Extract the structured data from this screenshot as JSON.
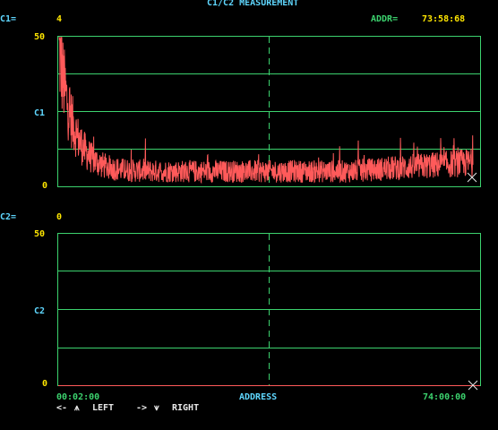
{
  "header": {
    "title": "C1/C2 MEASUREMENT",
    "addr_label": "ADDR=",
    "addr_value": "73:58:68"
  },
  "panel1": {
    "readout_label": "C1=",
    "readout_value": "4",
    "y_top": "50",
    "y_mid": "C1",
    "y_bottom": "0"
  },
  "panel2": {
    "readout_label": "C2=",
    "readout_value": "0",
    "y_top": "50",
    "y_mid": "C2",
    "y_bottom": "0"
  },
  "xaxis": {
    "start": "00:02:00",
    "label": "ADDRESS",
    "end": "74:00:00"
  },
  "footer": {
    "left_hint": "<-",
    "left_arrow": "⩚",
    "left_label": "LEFT",
    "right_hint": "->",
    "right_arrow": "⩛",
    "right_label": "RIGHT"
  },
  "colors": {
    "grid": "#3cd26e",
    "trace": "#ff5a5a",
    "label_cyan": "#5fd7ff",
    "value_yellow": "#ffe600"
  },
  "icons": [
    "cross-marker-icon",
    "arrow-up-icon",
    "arrow-down-icon"
  ],
  "chart_data": [
    {
      "type": "line",
      "name": "C1",
      "ylim": [
        0,
        50
      ],
      "y_ticks": [
        "0",
        "C1",
        "50"
      ],
      "x_ticks": [
        "00:02:00",
        "74:00:00"
      ],
      "xlabel": "ADDRESS",
      "shape": "spike near start (~45) decaying to noisy baseline (~3-8)",
      "peak": 45,
      "baseline": 5
    },
    {
      "type": "line",
      "name": "C2",
      "ylim": [
        0,
        50
      ],
      "y_ticks": [
        "0",
        "C2",
        "50"
      ],
      "x_ticks": [
        "00:02:00",
        "74:00:00"
      ],
      "xlabel": "ADDRESS",
      "values_constant": 0
    }
  ]
}
